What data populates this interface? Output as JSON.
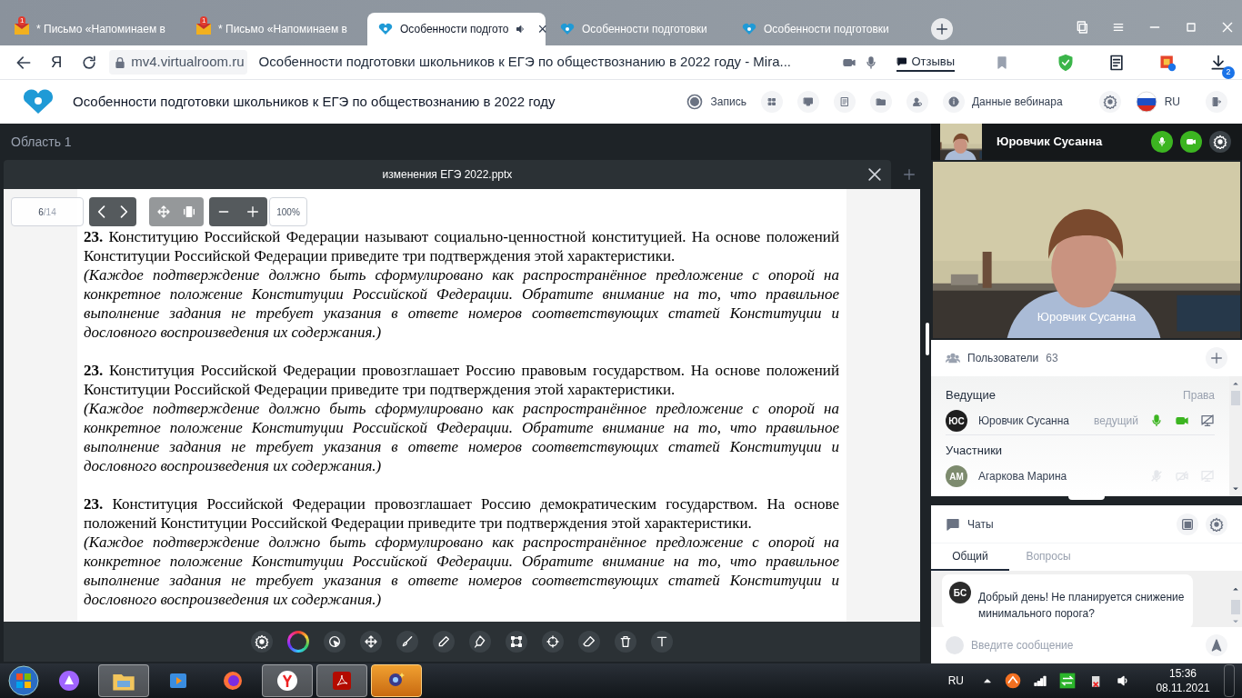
{
  "browser": {
    "tabs": [
      {
        "label": "* Письмо «Напоминаем в",
        "kind": "mail",
        "badge": "1",
        "selected": false
      },
      {
        "label": "* Письмо «Напоминаем в",
        "kind": "mail",
        "badge": "1",
        "selected": false
      },
      {
        "label": "Особенности подгото",
        "kind": "site",
        "close": "×",
        "sound": true,
        "selected": true
      },
      {
        "label": "Особенности подготовки",
        "kind": "site",
        "selected": false
      },
      {
        "label": "Особенности подготовки",
        "kind": "site",
        "selected": false
      }
    ],
    "url_host": "mv4.virtualroom.ru",
    "page_title": "Особенности подготовки школьников к ЕГЭ по обществознанию в 2022 году - Mira...",
    "reviews_label": "Отзывы",
    "yandex_letter": "Я",
    "downloads_badge": "2"
  },
  "app_header": {
    "title": "Особенности подготовки школьников к ЕГЭ по обществознанию в 2022 году",
    "record_label": "Запись",
    "webinar_info_label": "Данные вебинара",
    "language": "RU"
  },
  "workspace": {
    "area_label": "Область 1",
    "document": {
      "title": "изменения ЕГЭ 2022.pptx",
      "page": "6",
      "page_total": "/14",
      "zoom": "100%",
      "paragraphs": [
        {
          "number": "23.",
          "text": "Конституцию Российской Федерации называют социально-ценностной конституцией. На основе положений Конституции Российской Федерации приведите три подтверждения этой характеристики.",
          "note": "(Каждое подтверждение должно быть сформулировано как распространённое предложение с опорой на конкретное положение Конституции Российской Федерации. Обратите внимание на то, что правильное выполнение задания не требует указания в ответе номеров соответствующих статей Конституции и дословного воспроизведения их содержания.)"
        },
        {
          "number": "23.",
          "text": "Конституция Российской Федерации провозглашает Россию правовым государством. На основе положений Конституции Российской Федерации приведите три подтверждения этой характеристики.",
          "note": "(Каждое подтверждение должно быть сформулировано как распространённое предложение с опорой на конкретное положение Конституции Российской Федерации. Обратите внимание на то, что правильное выполнение задания не требует указания в ответе номеров соответствующих статей Конституции и дословного воспроизведения их содержания.)"
        },
        {
          "number": "23.",
          "text": "Конституция Российской Федерации провозглашает Россию демократическим государством. На основе положений Конституции Российской Федерации приведите три подтверждения этой характеристики.",
          "note": "(Каждое подтверждение должно быть сформулировано как распространённое предложение с опорой на конкретное положение Конституции Российской Федерации. Обратите внимание на то, что правильное выполнение задания не требует указания в ответе номеров соответствующих статей Конституции и дословного воспроизведения их содержания.)"
        }
      ]
    }
  },
  "video": {
    "name": "Юровчик Сусанна",
    "overlay_name": "Юровчик Сусанна",
    "mic_on": true,
    "camera_on": true
  },
  "users": {
    "title": "Пользователи",
    "count": "63",
    "groups": [
      {
        "title": "Ведущие",
        "rights_label": "Права",
        "members": [
          {
            "initials": "ЮС",
            "name": "Юровчик Сусанна",
            "role": "ведущий",
            "color": "#1f1f1f",
            "mic_on": true,
            "camera_on": true
          }
        ]
      },
      {
        "title": "Участники",
        "members": [
          {
            "initials": "АМ",
            "name": "Агаркова Марина",
            "color": "#7d8b6e",
            "mic_on": false,
            "camera_on": false
          }
        ]
      }
    ]
  },
  "chat": {
    "title": "Чаты",
    "tabs": [
      {
        "label": "Общий",
        "selected": true
      },
      {
        "label": "Вопросы",
        "selected": false
      }
    ],
    "messages": [
      {
        "initials": "БС",
        "text": "Добрый день! Не планируется снижение минимального порога?"
      }
    ],
    "placeholder": "Введите сообщение"
  },
  "taskbar": {
    "language": "RU",
    "time": "15:36",
    "date": "08.11.2021"
  }
}
